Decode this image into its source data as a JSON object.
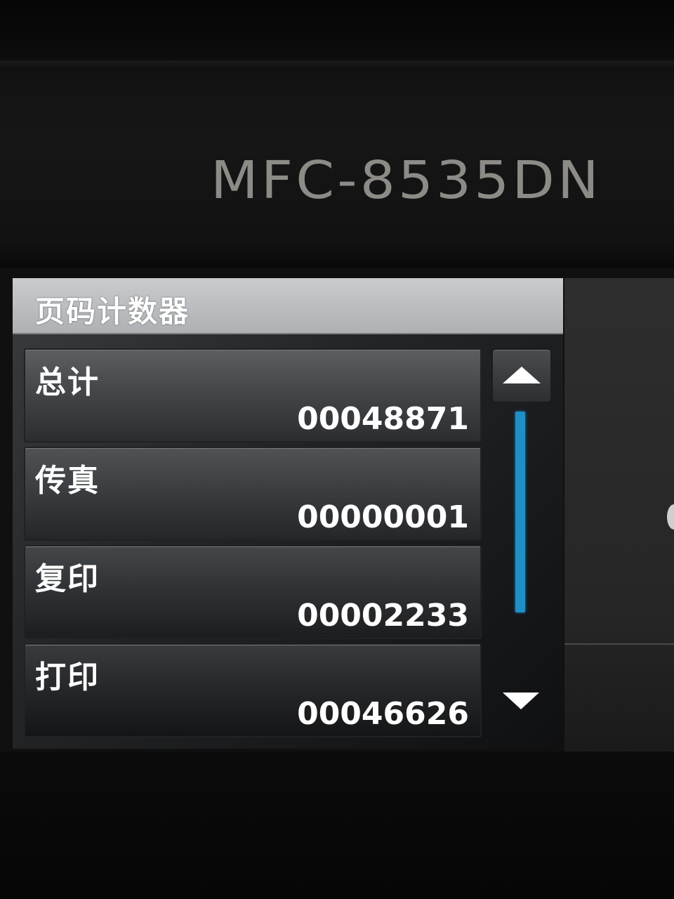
{
  "device": {
    "model": "MFC-8535DN"
  },
  "screen": {
    "title": "页码计数器",
    "counters": [
      {
        "label": "总计",
        "value": "00048871"
      },
      {
        "label": "传真",
        "value": "00000001"
      },
      {
        "label": "复印",
        "value": "00002233"
      },
      {
        "label": "打印",
        "value": "00046626"
      }
    ],
    "scroll": {
      "up_icon": "triangle-up-icon",
      "down_icon": "triangle-down-icon",
      "bar_color": "#1e90c8"
    }
  }
}
